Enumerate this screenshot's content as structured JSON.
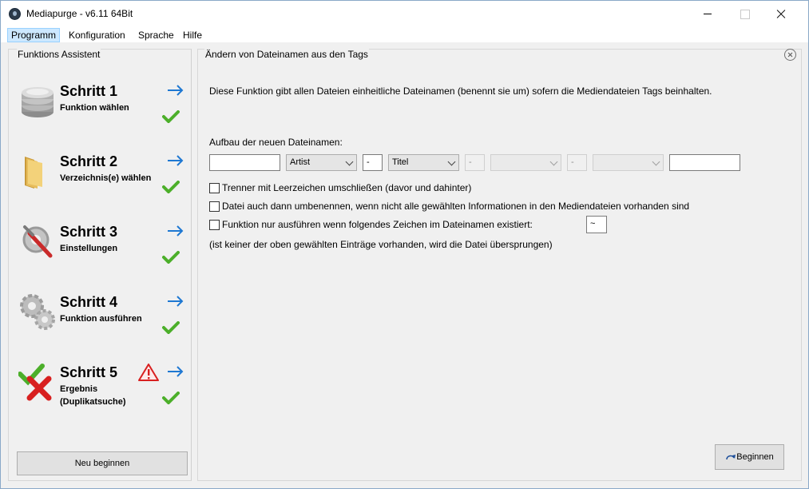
{
  "window": {
    "title": "Mediapurge - v6.11 64Bit"
  },
  "menu": [
    {
      "label": "Programm",
      "active": true
    },
    {
      "label": "Konfiguration",
      "active": false
    },
    {
      "label": "Sprache",
      "active": false
    },
    {
      "label": "Hilfe",
      "active": false
    }
  ],
  "left_panel": {
    "title": "Funktions Assistent",
    "steps": [
      {
        "title": "Schritt 1",
        "subtitle": "Funktion wählen",
        "icon": "database-icon",
        "done": true
      },
      {
        "title": "Schritt 2",
        "subtitle": "Verzeichnis(e) wählen",
        "icon": "folder-icon",
        "done": true
      },
      {
        "title": "Schritt 3",
        "subtitle": "Einstellungen",
        "icon": "settings-tools-icon",
        "done": true
      },
      {
        "title": "Schritt 4",
        "subtitle": "Funktion ausführen",
        "icon": "gears-icon",
        "done": true
      },
      {
        "title": "Schritt 5",
        "subtitle": "Ergebnis",
        "subtitle2": "(Duplikatsuche)",
        "icon": "result-check-x-icon",
        "warning": true,
        "done": true
      }
    ],
    "restart_button": "Neu beginnen"
  },
  "right_panel": {
    "title": "Ändern von Dateinamen aus den Tags",
    "description": "Diese Funktion gibt allen Dateien einheitliche Dateinamen (benennt sie um) sofern die Mediendateien Tags beinhalten.",
    "aufbau_label": "Aufbau der neuen Dateinamen:",
    "pattern": {
      "prefix": "",
      "tag1": "Artist",
      "sep1": "-",
      "tag2": "Titel",
      "sep2": "-",
      "tag3": "",
      "sep3": "-",
      "tag4": "",
      "suffix": ""
    },
    "options": [
      {
        "label": "Trenner mit Leerzeichen umschließen (davor und dahinter)",
        "checked": false
      },
      {
        "label": "Datei auch dann umbenennen, wenn nicht alle gewählten Informationen in den Mediendateien vorhanden sind",
        "checked": false
      },
      {
        "label": "Funktion nur ausführen wenn folgendes Zeichen im Dateinamen existiert:",
        "checked": false
      }
    ],
    "char_value": "~",
    "note": "(ist keiner der oben gewählten Einträge vorhanden, wird die Datei übersprungen)",
    "start_button": "Beginnen"
  },
  "colors": {
    "accent_arrow": "#1e78d2",
    "check_green": "#4caf2a",
    "warning_red": "#d82020"
  }
}
